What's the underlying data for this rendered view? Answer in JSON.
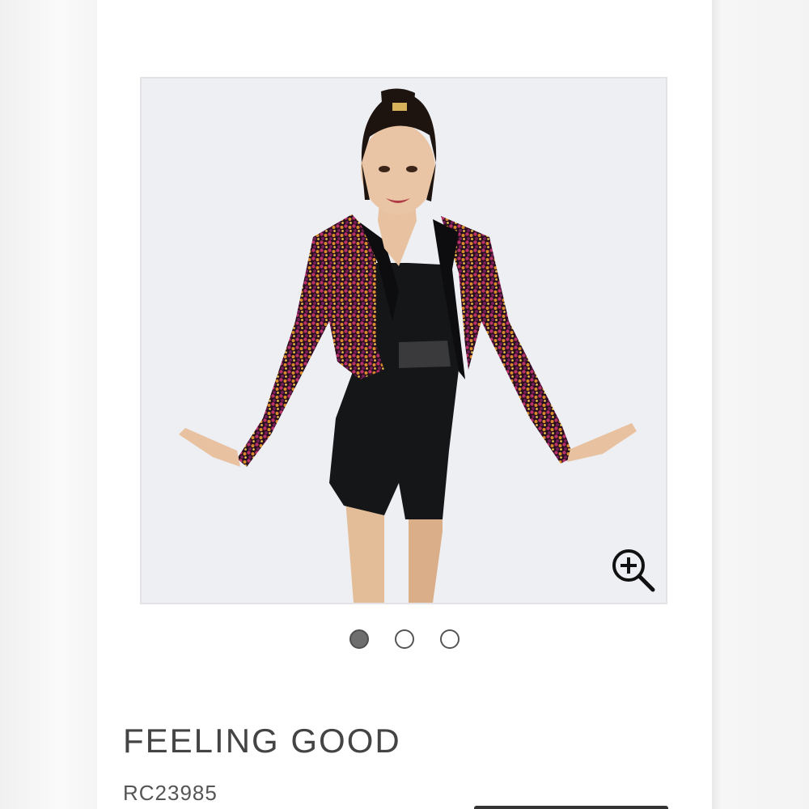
{
  "product": {
    "name": "FEELING GOOD",
    "sku": "RC23985"
  },
  "gallery": {
    "image_count": 3,
    "active_index": 0,
    "zoom_icon": "zoom-in-icon",
    "image_description_icon": "costume-photo"
  },
  "colors": {
    "page_background": "#ffffff",
    "gallery_background": "#eeeff3",
    "text_dark": "#444444",
    "dot_active": "#6e6e6e"
  }
}
